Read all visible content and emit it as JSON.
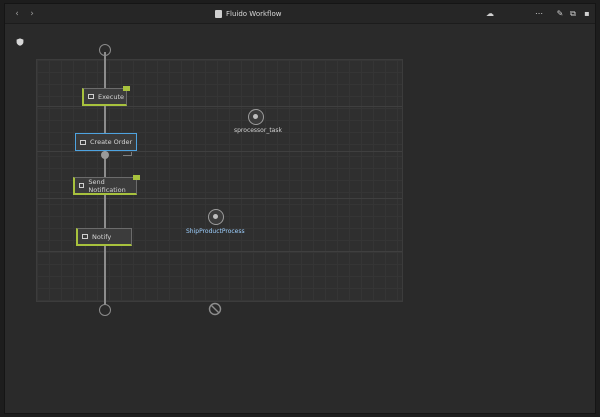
{
  "toolbar": {
    "back_icon": "chevron-left-icon",
    "forward_icon": "chevron-right-icon",
    "title": "Fluido Workflow",
    "buttons": [
      {
        "name": "cloud-icon",
        "glyph": "☁"
      },
      {
        "name": "more-icon",
        "glyph": "⋯"
      },
      {
        "name": "edit-icon",
        "glyph": "✎"
      },
      {
        "name": "copy-icon",
        "glyph": "⧉"
      },
      {
        "name": "delete-icon",
        "glyph": "▪"
      }
    ]
  },
  "left_panel": {
    "shield_icon": "shield-icon"
  },
  "workflow": {
    "nodes": [
      {
        "label": "Execute",
        "state": "green"
      },
      {
        "label": "Create Order",
        "state": "selected"
      },
      {
        "label": "Send Notification",
        "state": "green"
      },
      {
        "label": "Notify",
        "state": "green"
      }
    ],
    "side_tasks": [
      {
        "label": "sprocessor_task"
      },
      {
        "label": "ShipProductProcess"
      }
    ],
    "start_endpoint": "start-circle",
    "end_endpoint": "end-circle"
  }
}
